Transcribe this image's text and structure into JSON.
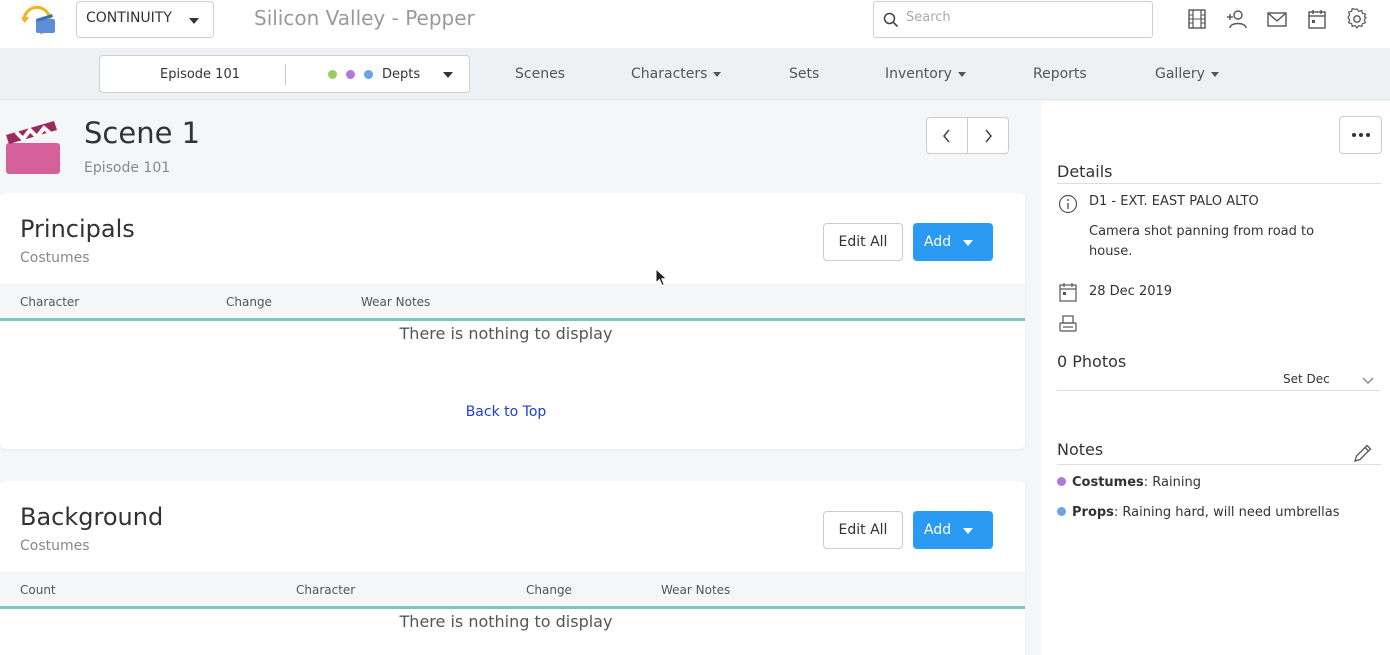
{
  "header": {
    "app_select": "CONTINUITY",
    "project_title": "Silicon Valley - Pepper",
    "search_placeholder": "Search",
    "icons": [
      "film-icon",
      "add-user-icon",
      "mail-icon",
      "calendar-icon",
      "settings-gear-icon"
    ]
  },
  "nav": {
    "episode": "Episode 101",
    "dept_dots": [
      "#9ccc5e",
      "#b07ad8",
      "#6aa3e8"
    ],
    "depts_label": "Depts",
    "items": [
      {
        "label": "Scenes",
        "dropdown": false
      },
      {
        "label": "Characters",
        "dropdown": true
      },
      {
        "label": "Sets",
        "dropdown": false
      },
      {
        "label": "Inventory",
        "dropdown": true
      },
      {
        "label": "Reports",
        "dropdown": false
      },
      {
        "label": "Gallery",
        "dropdown": true
      }
    ]
  },
  "scene": {
    "title": "Scene 1",
    "subtitle": "Episode 101",
    "icon_color": "#d6609a"
  },
  "principals": {
    "title": "Principals",
    "subtitle": "Costumes",
    "edit_label": "Edit All",
    "add_label": "Add",
    "columns": [
      "Character",
      "Change",
      "Wear Notes"
    ],
    "empty_text": "There is nothing to display",
    "back_to_top": "Back to Top"
  },
  "background": {
    "title": "Background",
    "subtitle": "Costumes",
    "edit_label": "Edit All",
    "add_label": "Add",
    "columns": [
      "Count",
      "Character",
      "Change",
      "Wear Notes"
    ],
    "empty_text": "There is nothing to display"
  },
  "details": {
    "title": "Details",
    "set": "D1 - EXT. EAST PALO ALTO",
    "description": "Camera shot panning from road to house.",
    "date": "28 Dec 2019",
    "photos_title": "0 Photos",
    "photos_filter": "Set Dec"
  },
  "notes": {
    "title": "Notes",
    "items": [
      {
        "dept": "Costumes",
        "text": ": Raining",
        "color": "#b07ad8"
      },
      {
        "dept": "Props",
        "text": ": Raining hard, will need umbrellas",
        "color": "#6aa3e8"
      }
    ]
  },
  "colors": {
    "accent_blue": "#2b9af3",
    "table_underline": "#7cc5c0",
    "link": "#1a3fd6"
  }
}
